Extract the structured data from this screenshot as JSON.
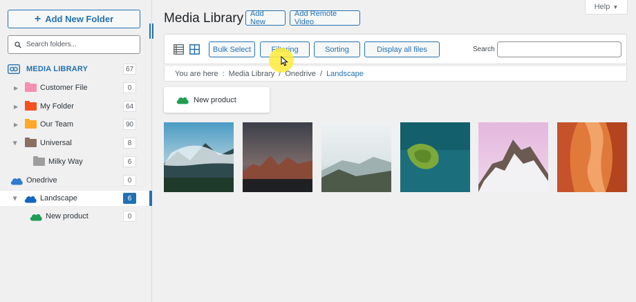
{
  "sidebar": {
    "add_folder_label": "Add New Folder",
    "search_placeholder": "Search folders...",
    "root": {
      "label": "MEDIA LIBRARY",
      "count": "67"
    },
    "items": [
      {
        "label": "Customer File",
        "count": "0",
        "color": "#f48fb1"
      },
      {
        "label": "My Folder",
        "count": "64",
        "color": "#f4511e"
      },
      {
        "label": "Our Team",
        "count": "90",
        "color": "#ffa726"
      },
      {
        "label": "Universal",
        "count": "8",
        "color": "#8d6e63"
      },
      {
        "label": "Milky Way",
        "count": "6",
        "color": "#9e9e9e"
      }
    ],
    "cloud": [
      {
        "label": "Onedrive",
        "count": "0",
        "color": "#2e7bd1"
      },
      {
        "label": "Landscape",
        "count": "6",
        "color": "#1565c0"
      },
      {
        "label": "New product",
        "count": "0",
        "color": "#1e9e53"
      }
    ]
  },
  "header": {
    "title": "Media Library",
    "add_new_label": "Add New",
    "add_remote_label": "Add Remote Video",
    "help_label": "Help"
  },
  "toolbar": {
    "bulk_select_label": "Bulk Select",
    "filtering_label": "Filtering",
    "sorting_label": "Sorting",
    "display_all_label": "Display all files",
    "search_label": "Search",
    "search_value": ""
  },
  "breadcrumb": {
    "prefix": "You are here",
    "separator": ":",
    "items": [
      "Media Library",
      "Onedrive",
      "Landscape"
    ],
    "divider": "/"
  },
  "subfolder": {
    "label": "New product"
  },
  "colors": {
    "accent": "#2271b1",
    "cloud_green": "#1e9e53"
  }
}
